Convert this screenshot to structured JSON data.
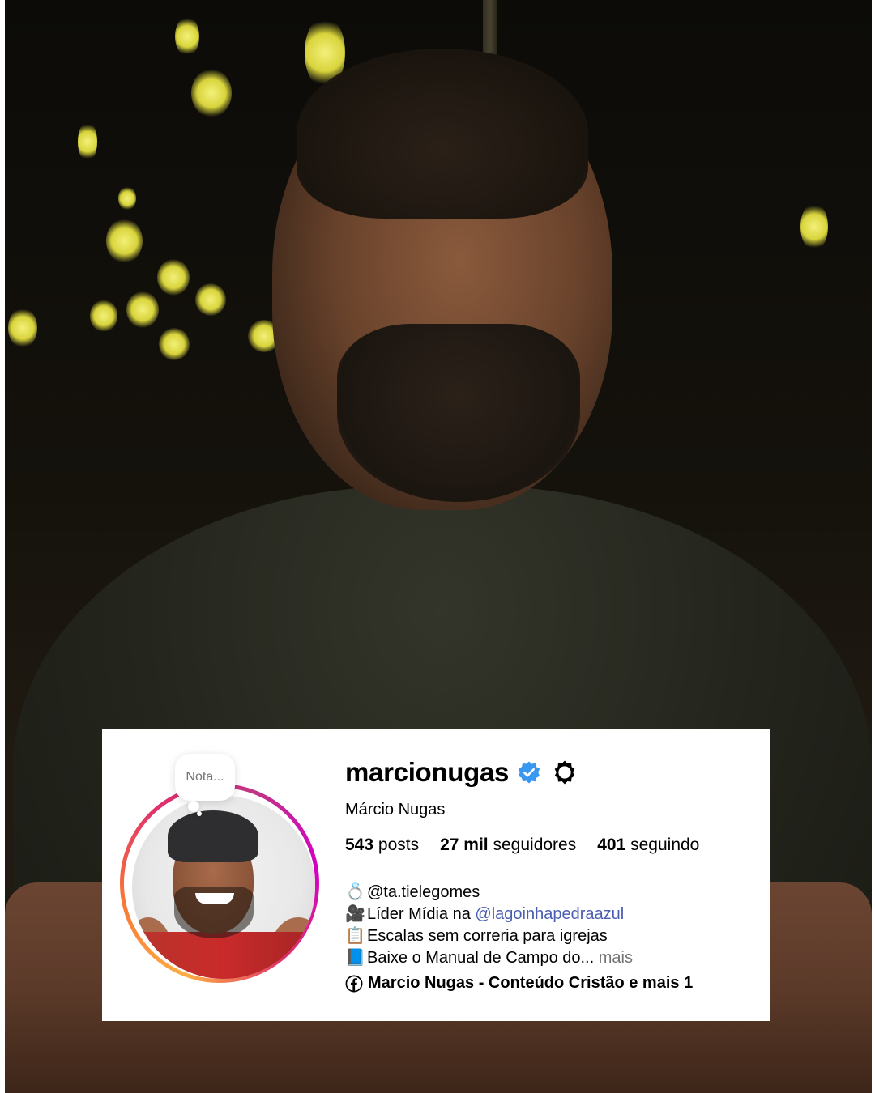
{
  "profile": {
    "note_placeholder": "Nota...",
    "username": "marcionugas",
    "full_name": "Márcio Nugas",
    "stats": {
      "posts_value": "543",
      "posts_label": "posts",
      "followers_value": "27 mil",
      "followers_label": "seguidores",
      "following_value": "401",
      "following_label": "seguindo"
    },
    "bio": {
      "line1_emoji": "💍",
      "line1_text": "@ta.tielegomes",
      "line2_emoji": "🎥",
      "line2_prefix": "Líder Mídia na ",
      "line2_mention": "@lagoinhapedraazul",
      "line3_emoji": "📋",
      "line3_text": "Escalas sem correria para igrejas",
      "line4_emoji": "📘",
      "line4_text": "Baixe o Manual de Campo do...",
      "line4_more": "mais"
    },
    "link_text": "Marcio Nugas - Conteúdo Cristão e mais 1",
    "verified_color": "#3897f0",
    "mention_color": "#4a5db0"
  },
  "icons": {
    "verified": "verified-badge-icon",
    "threads": "threads-icon",
    "facebook": "facebook-icon"
  }
}
